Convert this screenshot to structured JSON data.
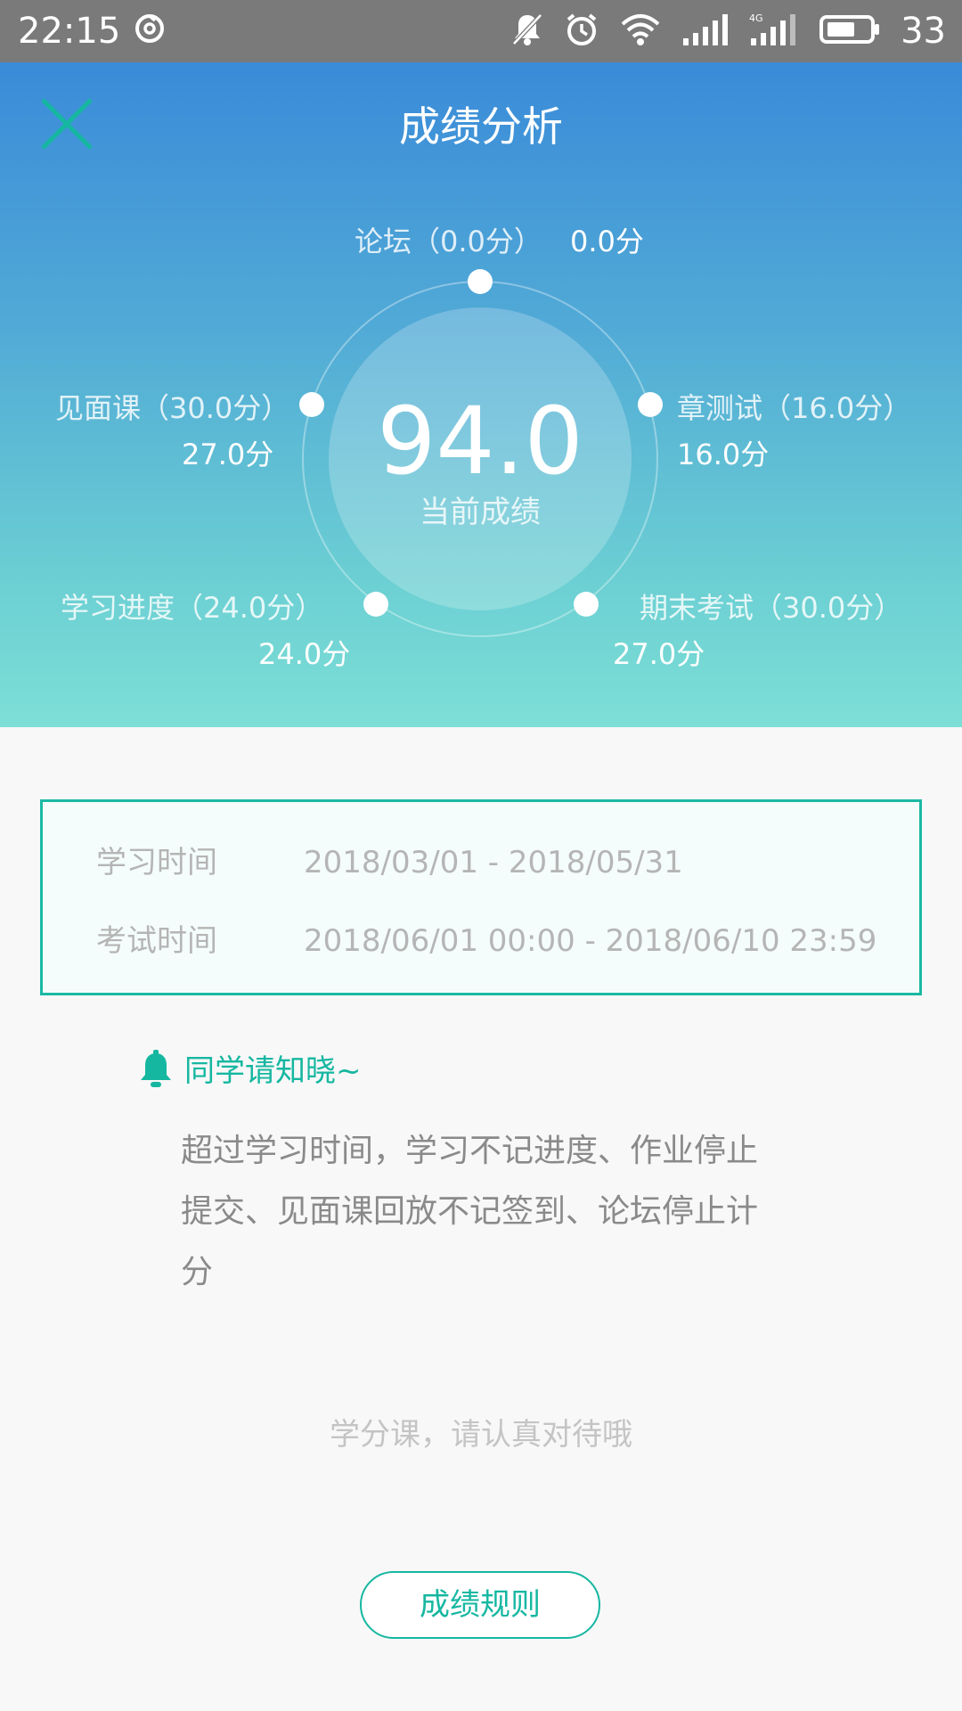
{
  "status_bar": {
    "time": "22:15",
    "battery": "33",
    "icons": [
      "netease-music-icon",
      "mute-bell-icon",
      "alarm-icon",
      "wifi-icon",
      "signal-icon",
      "4g-signal-icon",
      "battery-icon"
    ]
  },
  "header": {
    "title": "成绩分析",
    "close_icon": "close-icon"
  },
  "score": {
    "total": "94.0",
    "caption": "当前成绩"
  },
  "categories": [
    {
      "label": "论坛（0.0分）",
      "value": "0.0分"
    },
    {
      "label": "章测试（16.0分）",
      "value": "16.0分"
    },
    {
      "label": "期末考试（30.0分）",
      "value": "27.0分"
    },
    {
      "label": "学习进度（24.0分）",
      "value": "24.0分"
    },
    {
      "label": "见面课（30.0分）",
      "value": "27.0分"
    }
  ],
  "schedule": {
    "study_label": "学习时间",
    "study_value": "2018/03/01 - 2018/05/31",
    "exam_label": "考试时间",
    "exam_value": "2018/06/01 00:00 - 2018/06/10 23:59"
  },
  "notice": {
    "icon": "bell-icon",
    "title": "同学请知晓~",
    "body": "超过学习时间，学习不记进度、作业停止提交、见面课回放不记签到、论坛停止计分"
  },
  "reminder": "学分课，请认真对待哦",
  "rules_button": "成绩规则",
  "colors": {
    "accent": "#16b7a1",
    "hero_top": "#3a8bd8",
    "hero_bottom": "#7ddfd6"
  }
}
